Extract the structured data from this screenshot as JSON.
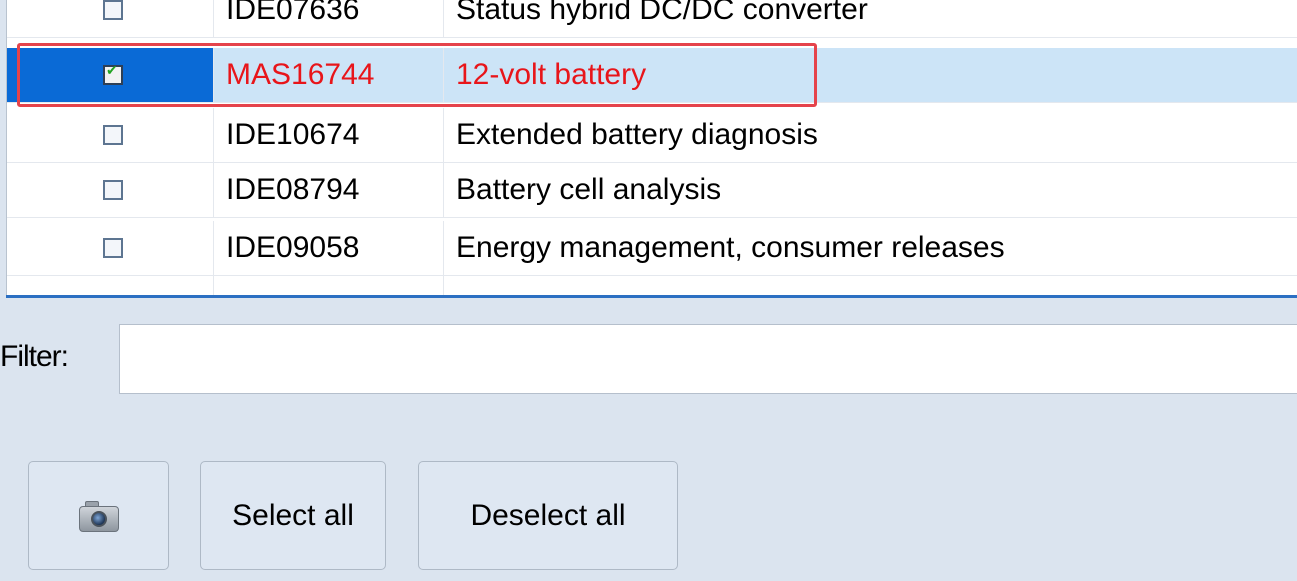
{
  "list": {
    "rows": [
      {
        "id": "IDE07636",
        "description": "Status hybrid DC/DC converter",
        "checked": false,
        "selected": false
      },
      {
        "id": "MAS16744",
        "description": "12-volt battery",
        "checked": true,
        "selected": true
      },
      {
        "id": "IDE10674",
        "description": "Extended battery diagnosis",
        "checked": false,
        "selected": false
      },
      {
        "id": "IDE08794",
        "description": "Battery cell analysis",
        "checked": false,
        "selected": false
      },
      {
        "id": "IDE09058",
        "description": "Energy management, consumer releases",
        "checked": false,
        "selected": false
      }
    ]
  },
  "filter": {
    "label": "Filter:",
    "value": "",
    "placeholder": ""
  },
  "buttons": {
    "camera_icon": "camera-icon",
    "select_all_label": "Select all",
    "deselect_all_label": "Deselect all"
  },
  "colors": {
    "selected_row_bg": "#cce4f7",
    "selected_check_cell_bg": "#0a6ad6",
    "selected_text": "#e8151a",
    "highlight_box": "#e5434b",
    "panel_bg": "#dbe4ef"
  }
}
